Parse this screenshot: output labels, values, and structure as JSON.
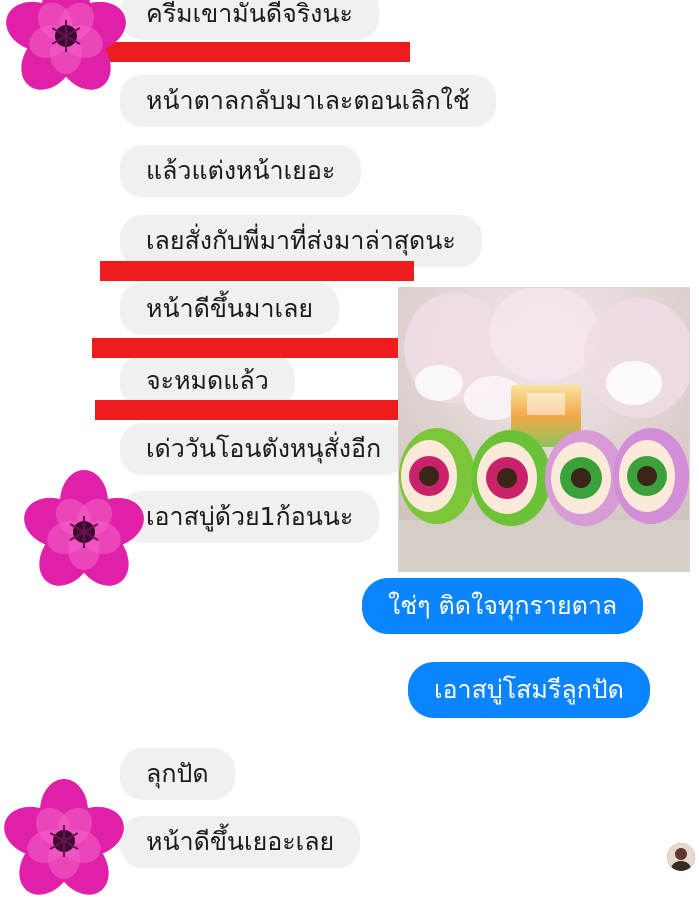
{
  "messages": [
    {
      "text": "ครีมเขามันดีจริงนะ",
      "direction": "incoming"
    },
    {
      "text": "หน้าตาลกลับมาเละตอนเลิกใช้",
      "direction": "incoming"
    },
    {
      "text": "แล้วแต่งหน้าเยอะ",
      "direction": "incoming"
    },
    {
      "text": "เลยสั่งกับพี่มาที่ส่งมาล่าสุดนะ",
      "direction": "incoming"
    },
    {
      "text": "หน้าดีขึ้นมาเลย",
      "direction": "incoming"
    },
    {
      "text": "จะหมดแล้ว",
      "direction": "incoming"
    },
    {
      "text": "เด่ววันโอนตังหนุสั่งอีก",
      "direction": "incoming"
    },
    {
      "text": "เอาสบู่ด้วย1ก้อนนะ",
      "direction": "incoming"
    },
    {
      "text": "ใช่ๆ ติดใจทุกรายตาล",
      "direction": "outgoing"
    },
    {
      "text": "เอาสบู่โสมรีลูกปัด",
      "direction": "outgoing"
    },
    {
      "text": "ลุกปัด",
      "direction": "incoming"
    },
    {
      "text": "หน้าดีขึ้นเยอะเลย",
      "direction": "incoming"
    }
  ],
  "colors": {
    "incoming_bubble": "#f1f0f0",
    "outgoing_bubble": "#0a84ff",
    "redaction": "#ee1d1d",
    "flower": "#e020a8"
  },
  "icons": {
    "sender_avatar": "pink-flower-icon",
    "read_receipt": "user-avatar"
  },
  "attachment": {
    "type": "photo",
    "subject": "soap and cream jars"
  }
}
